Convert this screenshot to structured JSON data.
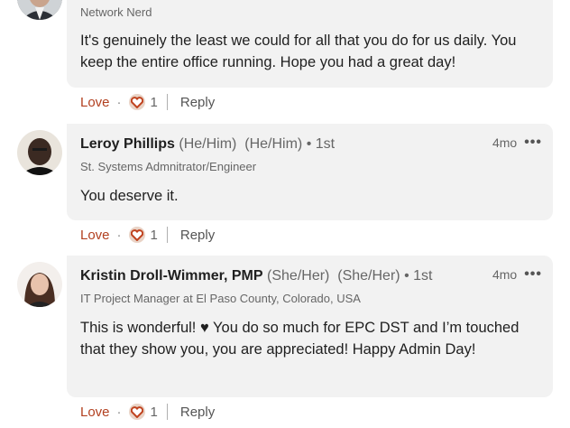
{
  "comments": [
    {
      "name": "",
      "pronouns": "",
      "degree": "",
      "headline": "Network Nerd",
      "time": "",
      "text": "It's genuinely the least we could for all that you do for us daily. You keep the entire office running. Hope you had a great day!",
      "love_label": "Love",
      "dot": "·",
      "reaction_count": "1",
      "reply_label": "Reply"
    },
    {
      "name": "Leroy Phillips",
      "pronouns": "(He/Him)  (He/Him)",
      "degree": "• 1st",
      "headline": "St. Systems Admnitrator/Engineer",
      "time": "4mo",
      "text": "You deserve it.",
      "love_label": "Love",
      "dot": "·",
      "reaction_count": "1",
      "reply_label": "Reply"
    },
    {
      "name": "Kristin Droll-Wimmer, PMP",
      "pronouns": "(She/Her)  (She/Her)",
      "degree": "• 1st",
      "headline": "IT Project Manager at El Paso County, Colorado, USA",
      "time": "4mo",
      "text": "This is wonderful! ♥ You do so much for EPC DST and I’m touched that they show you, you are appreciated! Happy Admin Day!",
      "love_label": "Love",
      "dot": "·",
      "reaction_count": "1",
      "reply_label": "Reply"
    }
  ],
  "more_icon": "ellipsis-icon",
  "colors": {
    "love": "#b24020",
    "bubble": "#f2f2f2",
    "muted": "#666666"
  }
}
